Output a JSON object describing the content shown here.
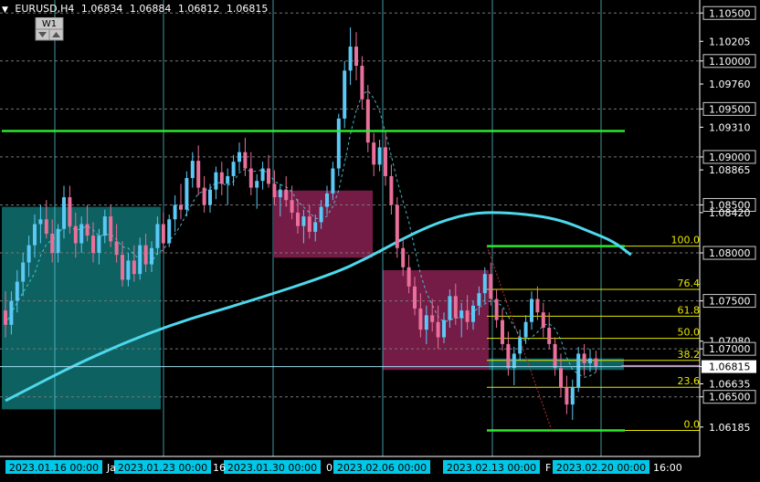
{
  "header": {
    "symbol": "EURUSD,H4",
    "open": "1.06834",
    "high": "1.06884",
    "low": "1.06812",
    "close": "1.06815"
  },
  "timeframe_button": {
    "label": "W1"
  },
  "colors": {
    "background": "#000000",
    "bull_candle": "#5bc8f5",
    "bear_candle": "#e8709a",
    "ma_line": "#4dd8ec",
    "resistance_line": "#2ee62e",
    "fib_line": "#e6e600",
    "price_line": "#9fdbf0",
    "demand_zone": "#0e6b6b",
    "supply_zone": "#7a1e4a",
    "axis_text": "#ffffff",
    "time_label_bg": "#00c8e8"
  },
  "price_axis": {
    "labels": [
      "1.10500",
      "1.10205",
      "1.10000",
      "1.09760",
      "1.09500",
      "1.09310",
      "1.09000",
      "1.08865",
      "1.08500",
      "1.08420",
      "1.08000",
      "1.07500",
      "1.07080",
      "1.07000",
      "1.06815",
      "1.06635",
      "1.06500",
      "1.06185"
    ],
    "boxed": [
      "1.10500",
      "1.10000",
      "1.09500",
      "1.09000",
      "1.08500",
      "1.08000",
      "1.07500",
      "1.07000",
      "1.06815",
      "1.06500"
    ]
  },
  "time_axis": {
    "labels": [
      "2023.01.16 00:00",
      "2023.01.23 00:00",
      "2023.01.30 00:00",
      "2023.02.06 00:00",
      "2023.02.13 00:00",
      "2023.02.20 00:00",
      "16:00"
    ],
    "partial": [
      "Ja",
      "16",
      "0",
      "F"
    ]
  },
  "fibonacci": {
    "levels": [
      {
        "label": "100.0",
        "price": 1.0807
      },
      {
        "label": "76.4",
        "price": 1.0762
      },
      {
        "label": "61.8",
        "price": 1.0734
      },
      {
        "label": "50.0",
        "price": 1.0711
      },
      {
        "label": "38.2",
        "price": 1.0688
      },
      {
        "label": "23.6",
        "price": 1.066
      },
      {
        "label": "0.0",
        "price": 1.0615
      }
    ]
  },
  "chart_data": {
    "type": "candlestick",
    "symbol": "EURUSD",
    "timeframe": "H4",
    "ylim": [
      1.0605,
      1.1055
    ],
    "current_price": 1.06815,
    "resistance": 1.0927,
    "candles": [
      [
        1.074,
        1.076,
        1.0712,
        1.0725
      ],
      [
        1.0725,
        1.076,
        1.0715,
        1.075
      ],
      [
        1.075,
        1.0782,
        1.0738,
        1.077
      ],
      [
        1.077,
        1.08,
        1.0755,
        1.079
      ],
      [
        1.079,
        1.0818,
        1.0775,
        1.0808
      ],
      [
        1.0808,
        1.084,
        1.0795,
        1.083
      ],
      [
        1.083,
        1.085,
        1.081,
        1.0835
      ],
      [
        1.0835,
        1.0855,
        1.0815,
        1.082
      ],
      [
        1.082,
        1.0835,
        1.079,
        1.08
      ],
      [
        1.08,
        1.083,
        1.079,
        1.0825
      ],
      [
        1.0825,
        1.087,
        1.0815,
        1.0858
      ],
      [
        1.0858,
        1.087,
        1.082,
        1.0828
      ],
      [
        1.0828,
        1.0842,
        1.0795,
        1.081
      ],
      [
        1.081,
        1.0838,
        1.08,
        1.083
      ],
      [
        1.083,
        1.085,
        1.0812,
        1.0818
      ],
      [
        1.0818,
        1.0832,
        1.079,
        1.08
      ],
      [
        1.08,
        1.0825,
        1.0788,
        1.0818
      ],
      [
        1.0818,
        1.0845,
        1.081,
        1.0838
      ],
      [
        1.0838,
        1.085,
        1.0806,
        1.0812
      ],
      [
        1.0812,
        1.083,
        1.079,
        1.0798
      ],
      [
        1.0798,
        1.0812,
        1.0765,
        1.0772
      ],
      [
        1.0772,
        1.08,
        1.0765,
        1.0792
      ],
      [
        1.0792,
        1.0808,
        1.077,
        1.0778
      ],
      [
        1.0778,
        1.0816,
        1.0772,
        1.0808
      ],
      [
        1.0808,
        1.082,
        1.078,
        1.0788
      ],
      [
        1.0788,
        1.0812,
        1.078,
        1.0805
      ],
      [
        1.0805,
        1.0838,
        1.0798,
        1.083
      ],
      [
        1.083,
        1.0842,
        1.08,
        1.081
      ],
      [
        1.081,
        1.084,
        1.0806,
        1.0835
      ],
      [
        1.0835,
        1.086,
        1.0822,
        1.085
      ],
      [
        1.085,
        1.0872,
        1.0835,
        1.0845
      ],
      [
        1.0845,
        1.0885,
        1.0838,
        1.0878
      ],
      [
        1.0878,
        1.0905,
        1.0868,
        1.0896
      ],
      [
        1.0896,
        1.0912,
        1.086,
        1.0868
      ],
      [
        1.0868,
        1.088,
        1.0842,
        1.085
      ],
      [
        1.085,
        1.0872,
        1.0842,
        1.0866
      ],
      [
        1.0866,
        1.089,
        1.0856,
        1.0884
      ],
      [
        1.0884,
        1.0895,
        1.086,
        1.0872
      ],
      [
        1.0872,
        1.0888,
        1.085,
        1.088
      ],
      [
        1.088,
        1.0902,
        1.087,
        1.0895
      ],
      [
        1.0895,
        1.0915,
        1.0885,
        1.0905
      ],
      [
        1.0905,
        1.092,
        1.088,
        1.0888
      ],
      [
        1.0888,
        1.0905,
        1.086,
        1.0868
      ],
      [
        1.0868,
        1.0882,
        1.0846,
        1.0875
      ],
      [
        1.0875,
        1.0895,
        1.0866,
        1.0888
      ],
      [
        1.0888,
        1.0902,
        1.0868,
        1.0872
      ],
      [
        1.0872,
        1.0886,
        1.085,
        1.0858
      ],
      [
        1.0858,
        1.0872,
        1.0838,
        1.0866
      ],
      [
        1.0866,
        1.088,
        1.0848,
        1.0855
      ],
      [
        1.0855,
        1.087,
        1.0835,
        1.0842
      ],
      [
        1.0842,
        1.0856,
        1.082,
        1.0828
      ],
      [
        1.0828,
        1.0845,
        1.081,
        1.0838
      ],
      [
        1.0838,
        1.085,
        1.0815,
        1.0822
      ],
      [
        1.0822,
        1.084,
        1.0812,
        1.0832
      ],
      [
        1.0832,
        1.0855,
        1.0825,
        1.0848
      ],
      [
        1.0848,
        1.087,
        1.084,
        1.0862
      ],
      [
        1.0862,
        1.0895,
        1.0855,
        1.0888
      ],
      [
        1.0888,
        1.0945,
        1.088,
        1.094
      ],
      [
        1.094,
        1.1,
        1.093,
        1.099
      ],
      [
        1.099,
        1.1035,
        1.0975,
        1.1015
      ],
      [
        1.1015,
        1.103,
        1.098,
        1.0995
      ],
      [
        1.0995,
        1.1005,
        1.095,
        1.096
      ],
      [
        1.096,
        1.0975,
        1.0905,
        1.0915
      ],
      [
        1.0915,
        1.0925,
        1.088,
        1.0892
      ],
      [
        1.0892,
        1.0918,
        1.0885,
        1.091
      ],
      [
        1.091,
        1.0925,
        1.087,
        1.088
      ],
      [
        1.088,
        1.0892,
        1.084,
        1.085
      ],
      [
        1.085,
        1.0858,
        1.0795,
        1.0805
      ],
      [
        1.0805,
        1.0815,
        1.0776,
        1.0785
      ],
      [
        1.0785,
        1.0798,
        1.0758,
        1.0765
      ],
      [
        1.0765,
        1.0775,
        1.0735,
        1.0742
      ],
      [
        1.0742,
        1.0758,
        1.0712,
        1.072
      ],
      [
        1.072,
        1.0745,
        1.0705,
        1.0735
      ],
      [
        1.0735,
        1.0752,
        1.0718,
        1.0728
      ],
      [
        1.0728,
        1.0745,
        1.07,
        1.0712
      ],
      [
        1.0712,
        1.0738,
        1.0706,
        1.073
      ],
      [
        1.073,
        1.0762,
        1.0722,
        1.0755
      ],
      [
        1.0755,
        1.0768,
        1.0725,
        1.0732
      ],
      [
        1.0732,
        1.0748,
        1.0712,
        1.074
      ],
      [
        1.074,
        1.0756,
        1.072,
        1.0728
      ],
      [
        1.0728,
        1.075,
        1.072,
        1.0745
      ],
      [
        1.0745,
        1.0765,
        1.0735,
        1.0758
      ],
      [
        1.0758,
        1.0785,
        1.0748,
        1.0778
      ],
      [
        1.0778,
        1.079,
        1.0745,
        1.0752
      ],
      [
        1.0752,
        1.0762,
        1.0722,
        1.073
      ],
      [
        1.073,
        1.0742,
        1.0698,
        1.0705
      ],
      [
        1.0705,
        1.0718,
        1.0672,
        1.068
      ],
      [
        1.068,
        1.0702,
        1.0662,
        1.0695
      ],
      [
        1.0695,
        1.072,
        1.0688,
        1.0712
      ],
      [
        1.0712,
        1.0735,
        1.0705,
        1.0728
      ],
      [
        1.0728,
        1.076,
        1.072,
        1.0752
      ],
      [
        1.0752,
        1.0765,
        1.073,
        1.0738
      ],
      [
        1.0738,
        1.0748,
        1.0712,
        1.0722
      ],
      [
        1.0722,
        1.0738,
        1.07,
        1.0705
      ],
      [
        1.0705,
        1.0712,
        1.0672,
        1.068
      ],
      [
        1.068,
        1.0695,
        1.065,
        1.066
      ],
      [
        1.066,
        1.0672,
        1.0632,
        1.0642
      ],
      [
        1.0642,
        1.0668,
        1.0626,
        1.066
      ],
      [
        1.066,
        1.0702,
        1.0655,
        1.0695
      ],
      [
        1.0695,
        1.0705,
        1.0672,
        1.0685
      ],
      [
        1.0685,
        1.07,
        1.0676,
        1.069
      ],
      [
        1.069,
        1.0698,
        1.0676,
        1.0682
      ]
    ],
    "ma_points": [
      [
        0,
        1.0646
      ],
      [
        14,
        1.069
      ],
      [
        28,
        1.0725
      ],
      [
        42,
        1.075
      ],
      [
        56,
        1.0778
      ],
      [
        62,
        1.0795
      ],
      [
        68,
        1.0815
      ],
      [
        74,
        1.0832
      ],
      [
        80,
        1.0842
      ],
      [
        86,
        1.0842
      ],
      [
        92,
        1.0838
      ],
      [
        96,
        1.0832
      ],
      [
        100,
        1.0822
      ],
      [
        104,
        1.0812
      ],
      [
        107,
        1.0798
      ]
    ]
  }
}
